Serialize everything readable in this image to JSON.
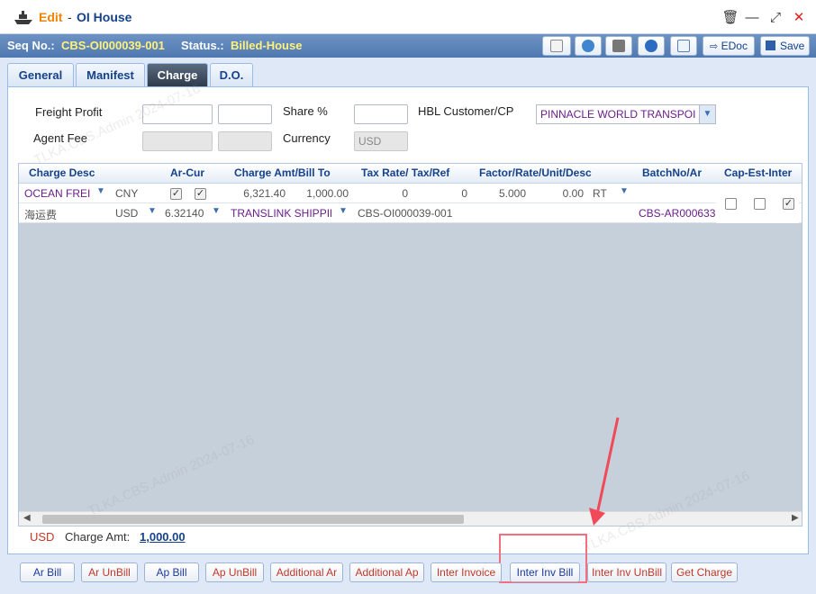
{
  "titlebar": {
    "edit_label": "Edit",
    "dash": "-",
    "title": "OI House",
    "window_controls": [
      "trash-icon",
      "minimize-icon",
      "maximize-icon",
      "close-icon"
    ]
  },
  "infobar": {
    "seq_label": "Seq No.:",
    "seq_value": "CBS-OI000039-001",
    "status_label": "Status.:",
    "status_value": "Billed-House",
    "edoc_label": "EDoc",
    "save_label": "Save"
  },
  "tabs": [
    {
      "label": "General",
      "active": false
    },
    {
      "label": "Manifest",
      "active": false
    },
    {
      "label": "Charge",
      "active": true
    },
    {
      "label": "D.O.",
      "active": false
    }
  ],
  "form": {
    "freight_profit_label": "Freight Profit",
    "agent_fee_label": "Agent Fee",
    "share_label": "Share %",
    "currency_label": "Currency",
    "currency_value": "USD",
    "hbl_customer_label": "HBL Customer/CP",
    "hbl_customer_value": "PINNACLE WORLD TRANSPOI"
  },
  "grid": {
    "headers": [
      "Charge Desc",
      "Ar-Cur",
      "Charge Amt/Bill To",
      "Tax Rate/ Tax/Ref",
      "Factor/Rate/Unit/Desc",
      "BatchNo/Ar",
      "Cap-Est-Inter"
    ],
    "row1": {
      "charge_desc": "OCEAN FREI",
      "cur": "CNY",
      "amount": "6,321.40",
      "bill_amount": "1,000.00",
      "tax_rate": "0",
      "tax": "0",
      "factor": "5.000",
      "rate": "0.00",
      "unit": "RT"
    },
    "row2": {
      "charge_desc": "海运费",
      "cur": "USD",
      "exchange": "6.32140",
      "bill_to": "TRANSLINK SHIPPIN",
      "ref": "CBS-OI000039-001",
      "batch": "CBS-AR000633"
    }
  },
  "summary": {
    "currency": "USD",
    "charge_amt_label": "Charge Amt:",
    "charge_amt_value": "1,000.00"
  },
  "buttons": {
    "ar_bill": "Ar Bill",
    "ar_unbill": "Ar UnBill",
    "ap_bill": "Ap Bill",
    "ap_unbill": "Ap UnBill",
    "additional_ar": "Additional Ar",
    "additional_ap": "Additional Ap",
    "inter_invoice": "Inter Invoice",
    "inter_inv_bill": "Inter Inv Bill",
    "inter_inv_unbill": "Inter Inv UnBill",
    "get_charge": "Get Charge"
  },
  "watermark_text": "TLKA.CBS.Admin 2024-07-16",
  "colors": {
    "infobar": "#4f79b1",
    "highlight": "#f07080",
    "accent_orange": "#f08300"
  }
}
